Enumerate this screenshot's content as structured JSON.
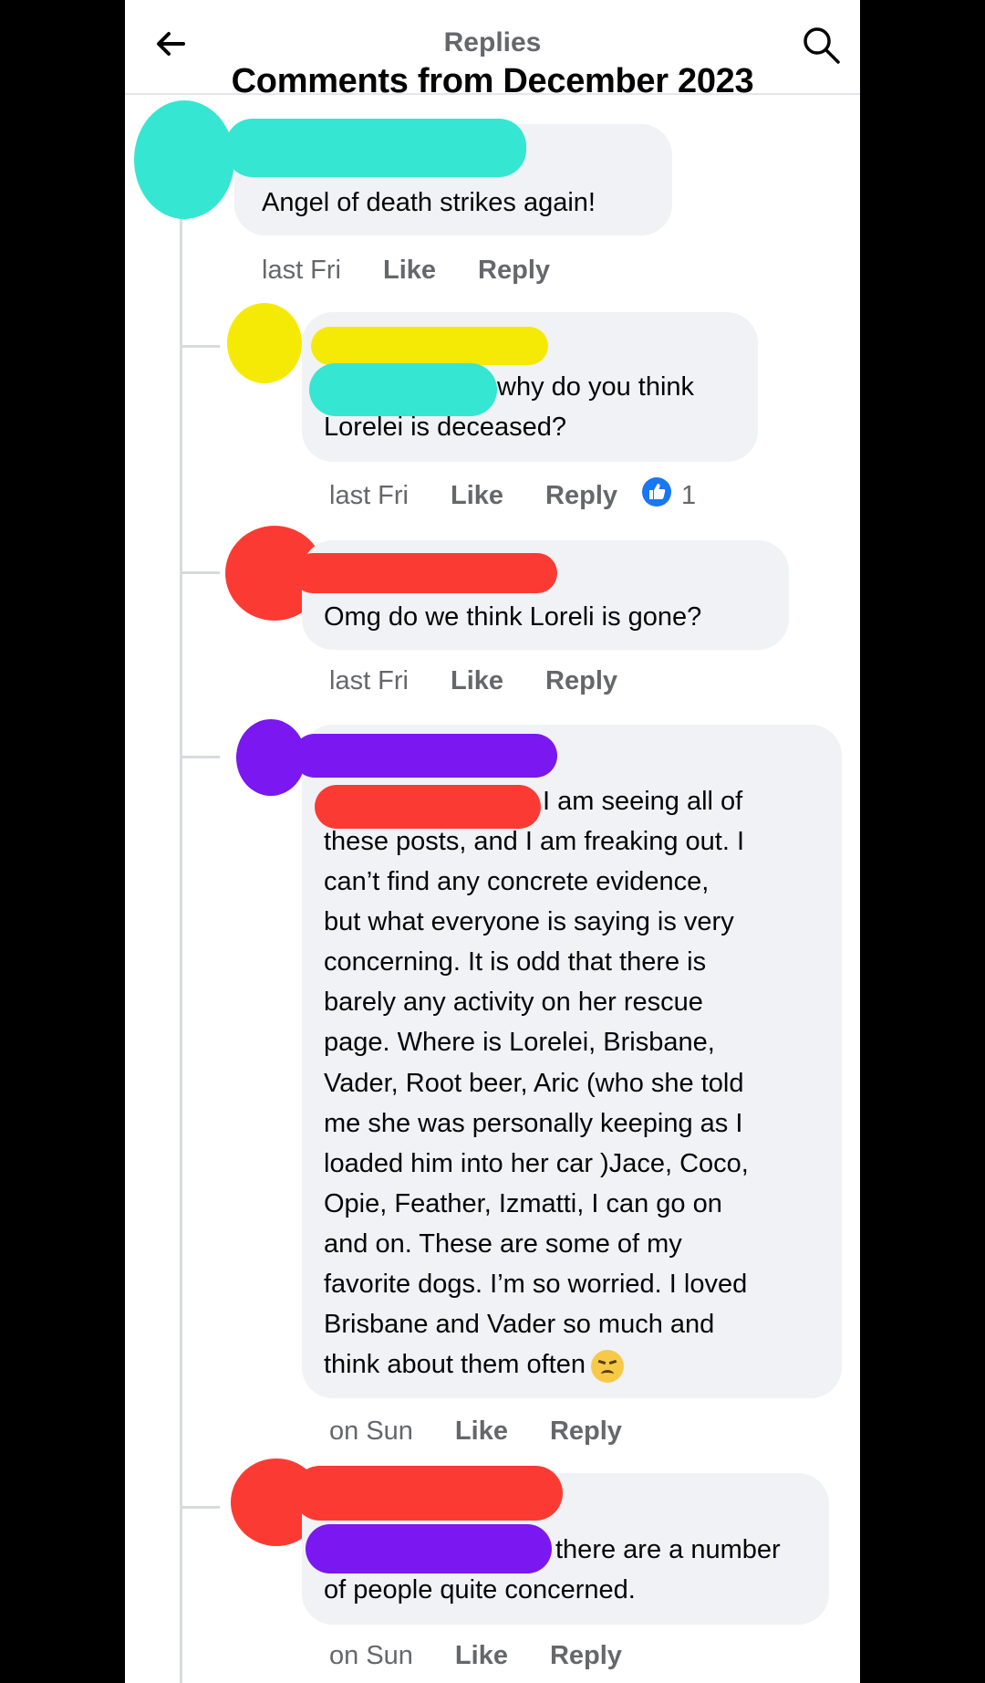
{
  "header": {
    "title": "Replies",
    "overlay_caption": "Comments from December 2023"
  },
  "comments": [
    {
      "text": "Angel of death strikes again!",
      "time": "last Fri",
      "like": "Like",
      "reply": "Reply"
    },
    {
      "text_part1": "why do you think",
      "text_part2": "Lorelei is deceased?",
      "time": "last Fri",
      "like": "Like",
      "reply": "Reply",
      "reaction_count": "1"
    },
    {
      "text": "Omg do we think Loreli is gone?",
      "time": "last Fri",
      "like": "Like",
      "reply": "Reply"
    },
    {
      "text_first_line": "I am seeing all of",
      "text_rest": [
        "these posts, and I am freaking out. I",
        "can’t find any concrete evidence,",
        "but what everyone is saying is very",
        "concerning. It is odd that there is",
        "barely any activity on her rescue",
        "page. Where is Lorelei, Brisbane,",
        "Vader, Root beer, Aric (who she told",
        "me she was personally keeping as I",
        "loaded him into her car )Jace, Coco,",
        "Opie, Feather, Izmatti, I can go on",
        "and on. These are some of my",
        "favorite dogs. I’m so worried. I loved",
        "Brisbane and Vader so much and",
        "think about them often"
      ],
      "emoji": "disappointed-face",
      "time": "on Sun",
      "like": "Like",
      "reply": "Reply"
    },
    {
      "text_part1": "there are a number",
      "text_part2": "of people quite concerned.",
      "time": "on Sun",
      "like": "Like",
      "reply": "Reply"
    }
  ],
  "colors": {
    "redaction_teal": "#35e6d2",
    "redaction_yellow": "#f5ea06",
    "redaction_red": "#fb3b33",
    "redaction_purple": "#7b17f0",
    "like_blue": "#1877f2"
  }
}
